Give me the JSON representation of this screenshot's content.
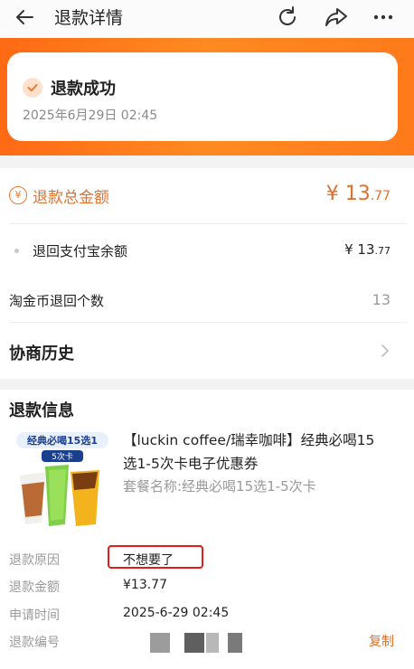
{
  "header": {
    "title": "退款详情",
    "icons": [
      "back-arrow-icon",
      "refresh-icon",
      "share-icon",
      "more-icon"
    ]
  },
  "status": {
    "text": "退款成功",
    "time": "2025年6月29日 02:45"
  },
  "total": {
    "label": "退款总金额",
    "currency": "¥",
    "integer": "13",
    "decimal": ".77"
  },
  "refund_to": {
    "label": "退回支付宝余额",
    "currency": "¥",
    "integer": "13",
    "decimal": ".77"
  },
  "coins": {
    "label": "淘金币退回个数",
    "value": "13"
  },
  "history": {
    "label": "协商历史"
  },
  "refund_info": {
    "title": "退款信息",
    "product": {
      "image_badge": "经典必喝15选1",
      "image_card": "5次卡",
      "title": "【luckin coffee/瑞幸咖啡】经典必喝15选1-5次卡电子优惠券",
      "package": "套餐名称:经典必喝15选1-5次卡"
    },
    "rows": [
      {
        "label": "退款原因",
        "value": "不想要了"
      },
      {
        "label": "退款金额",
        "value": "¥13.77"
      },
      {
        "label": "申请时间",
        "value": "2025-6-29 02:45"
      },
      {
        "label": "退款编号",
        "value": ""
      }
    ],
    "copy_label": "复制"
  },
  "colors": {
    "accent": "#e0702c",
    "hero_gradient_start": "#ff6a14",
    "hero_gradient_end": "#ff8a21",
    "highlight_border": "#e21b1b"
  }
}
